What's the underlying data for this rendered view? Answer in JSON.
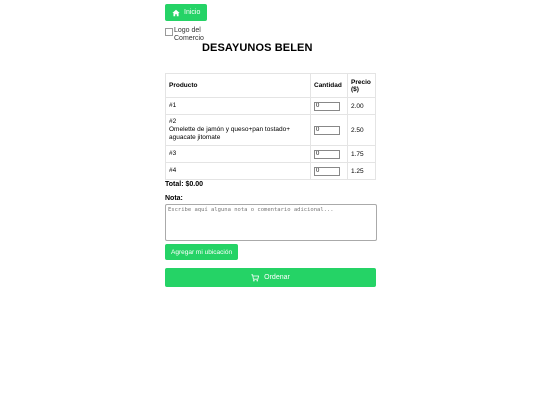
{
  "header": {
    "home_label": "Inicio",
    "logo_alt": "Logo del Comercio",
    "title": "DESAYUNOS BELEN"
  },
  "table": {
    "columns": [
      "Producto",
      "Cantidad",
      "Precio ($)"
    ],
    "rows": [
      {
        "name_line1": "#1",
        "name_line2": "",
        "qty": "0",
        "price": "2.00"
      },
      {
        "name_line1": "#2",
        "name_line2": "Omelette de jamón y queso+pan tostado+ aguacate jitomate",
        "qty": "0",
        "price": "2.50"
      },
      {
        "name_line1": "#3",
        "name_line2": "",
        "qty": "0",
        "price": "1.75"
      },
      {
        "name_line1": "#4",
        "name_line2": "",
        "qty": "0",
        "price": "1.25"
      }
    ]
  },
  "total_text": "Total: $0.00",
  "note": {
    "label": "Nota:",
    "placeholder": "Escribe aquí alguna nota o comentario adicional..."
  },
  "location_label": "Agregar mi ubicación",
  "order_label": "Ordenar",
  "colors": {
    "accent": "#25d366"
  },
  "icons": {
    "home": "home-icon",
    "cart": "cart-icon"
  }
}
